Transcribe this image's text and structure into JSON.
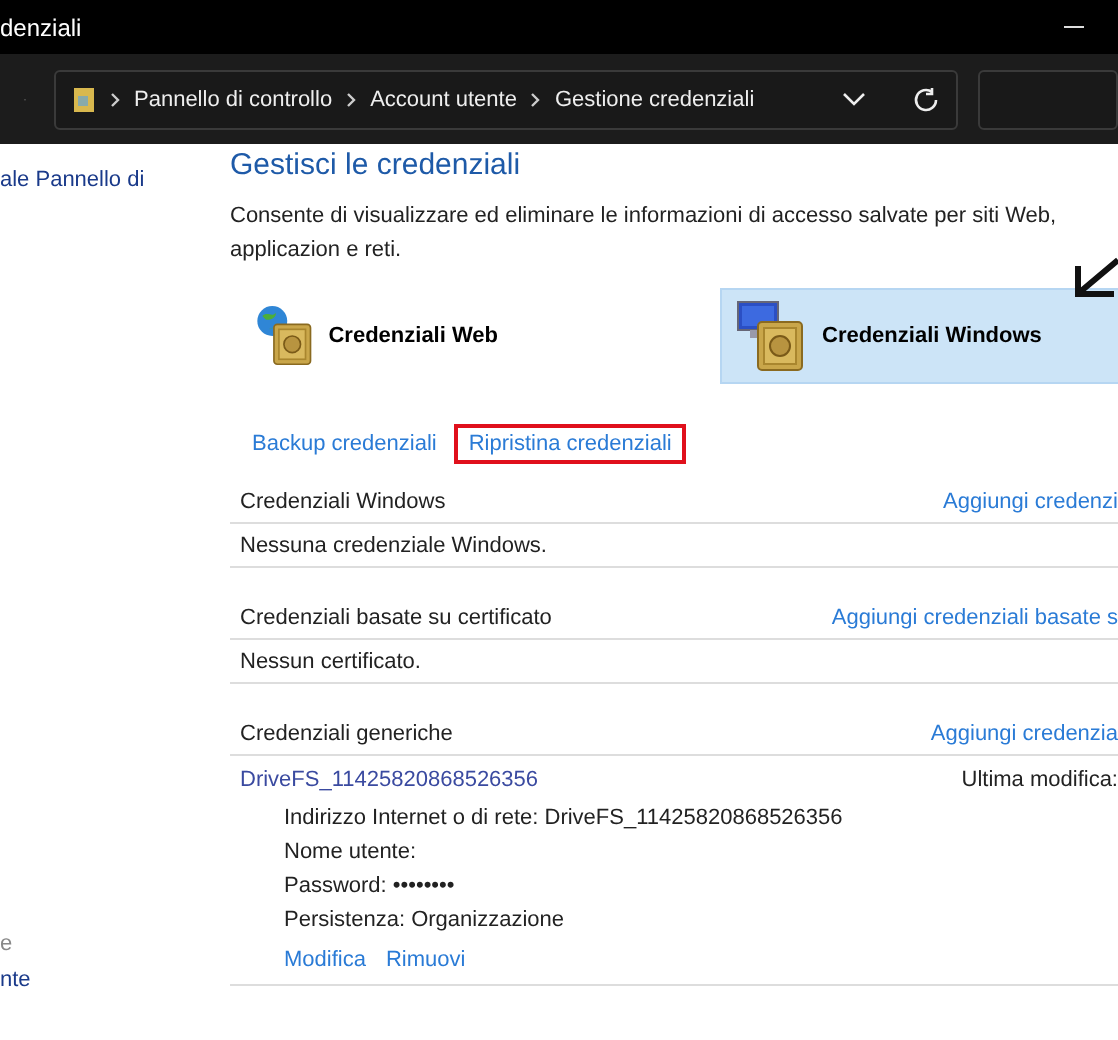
{
  "window": {
    "title": "denziali"
  },
  "address_bar": {
    "crumbs": [
      "Pannello di controllo",
      "Account utente",
      "Gestione credenziali"
    ]
  },
  "sidebar": {
    "items": [
      {
        "label": "ale Pannello di",
        "kind": "link"
      },
      {
        "label": "e",
        "kind": "muted"
      },
      {
        "label": "nte",
        "kind": "link"
      }
    ]
  },
  "main": {
    "title": "Gestisci le credenziali",
    "description": "Consente di visualizzare ed eliminare le informazioni di accesso salvate per siti Web, applicazion e reti.",
    "tiles": [
      {
        "label": "Credenziali Web",
        "kind": "web",
        "selected": false
      },
      {
        "label": "Credenziali Windows",
        "kind": "windows",
        "selected": true
      }
    ],
    "actions": [
      {
        "label": "Backup credenziali",
        "highlighted": false
      },
      {
        "label": "Ripristina credenziali",
        "highlighted": true
      }
    ],
    "sections": [
      {
        "title": "Credenziali Windows",
        "add_link": "Aggiungi credenzi",
        "empty_text": "Nessuna credenziale Windows."
      },
      {
        "title": "Credenziali basate su certificato",
        "add_link": "Aggiungi credenziali basate s",
        "empty_text": "Nessun certificato."
      },
      {
        "title": "Credenziali generiche",
        "add_link": "Aggiungi credenzia",
        "entries": [
          {
            "name": "DriveFS_11425820868526356",
            "modified": "Ultima modifica:",
            "details": [
              {
                "label": "Indirizzo Internet o di rete:",
                "value": "DriveFS_11425820868526356"
              },
              {
                "label": "Nome utente:"
              },
              {
                "label": "Password:",
                "value": "••••••••"
              },
              {
                "label": "Persistenza:",
                "value": "Organizzazione"
              }
            ],
            "links": [
              "Modifica",
              "Rimuovi"
            ]
          }
        ]
      }
    ]
  }
}
